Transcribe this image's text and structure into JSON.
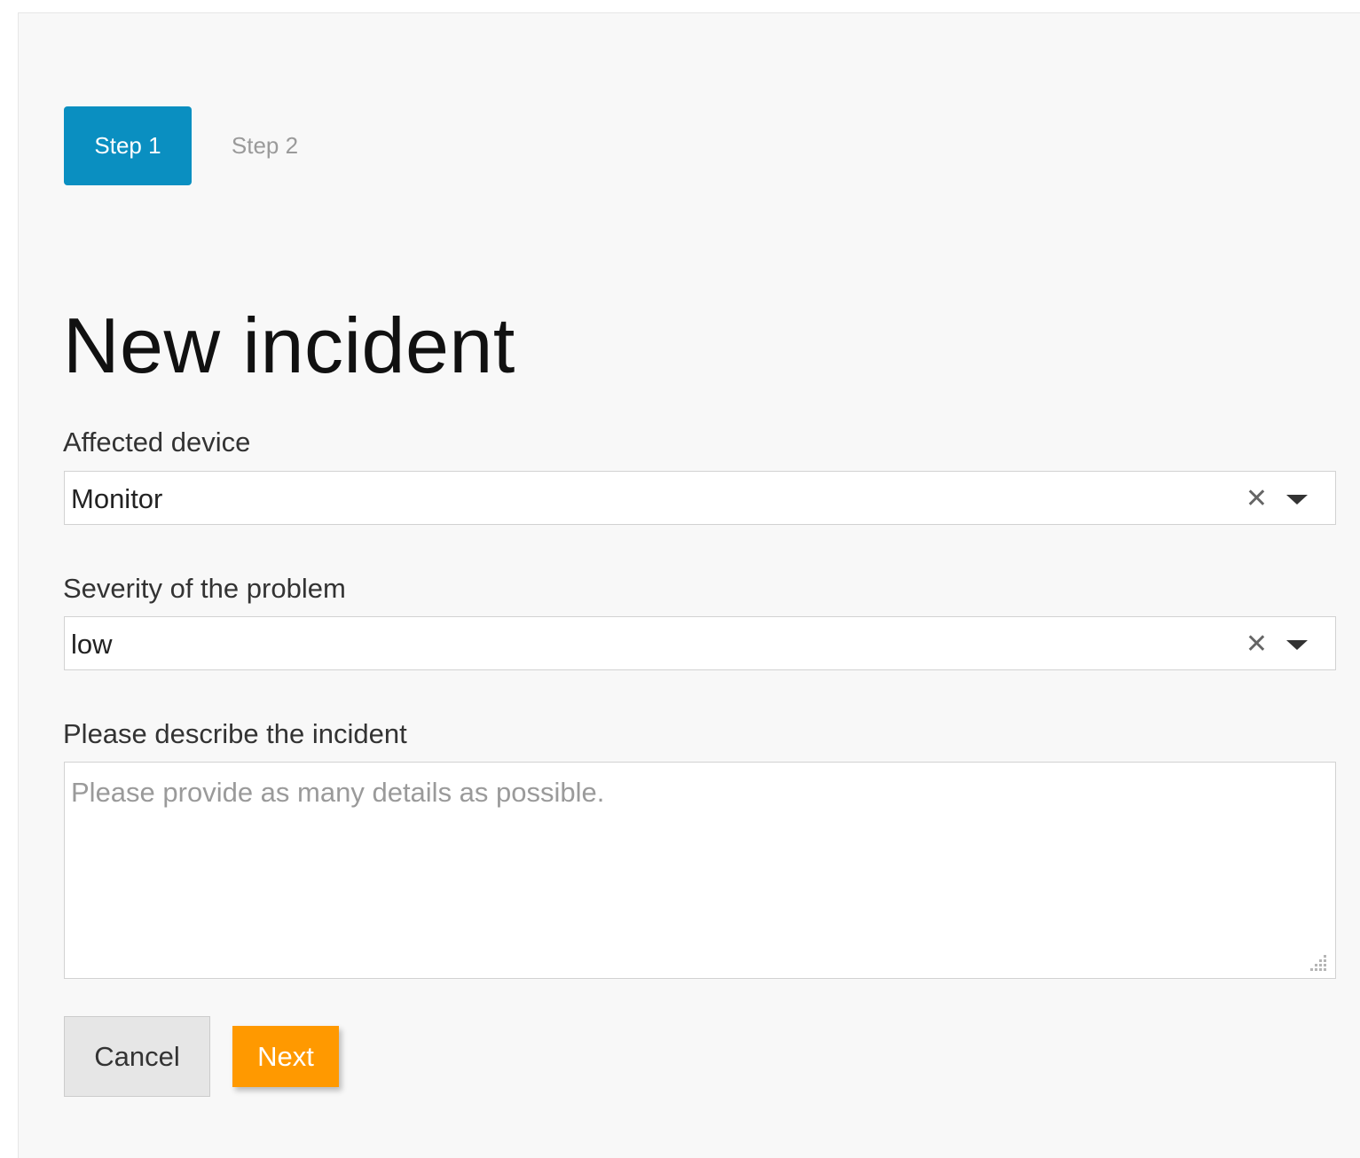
{
  "wizard": {
    "steps": [
      {
        "label": "Step 1",
        "active": true
      },
      {
        "label": "Step 2",
        "active": false
      }
    ],
    "accent_color": "#0a8fc1"
  },
  "form": {
    "title": "New incident",
    "affected_device": {
      "label": "Affected device",
      "value": "Monitor",
      "clear_glyph": "✕"
    },
    "severity": {
      "label": "Severity of the problem",
      "value": "low",
      "clear_glyph": "✕"
    },
    "description": {
      "label": "Please describe the incident",
      "placeholder": "Please provide as many details as possible.",
      "value": ""
    },
    "buttons": {
      "cancel": "Cancel",
      "next": "Next",
      "next_color": "#ff9900"
    }
  }
}
